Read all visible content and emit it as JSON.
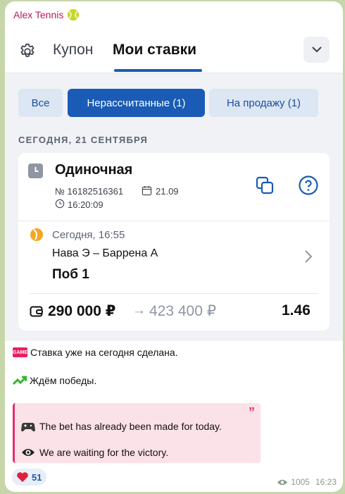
{
  "channel": {
    "sender_name": "Alex Tennis",
    "sender_icon": "tennis-ball-icon"
  },
  "header": {
    "settings_icon": "gear-icon",
    "tab_coupon": "Купон",
    "tab_my_bets": "Мои ставки",
    "collapse_icon": "chevron-down-icon"
  },
  "filters": {
    "all": "Все",
    "unsettled": "Нерассчитанные (1)",
    "for_sale": "На продажу (1)"
  },
  "section_date": "СЕГОДНЯ, 21 СЕНТЯБРЯ",
  "bet": {
    "type": "Одиночная",
    "number": "№ 16182516361",
    "date": "21.09",
    "time": "16:20:09",
    "event_time": "Сегодня, 16:55",
    "event_name": "Нава Э – Баррена А",
    "pick": "Поб 1",
    "stake": "290 000 ₽",
    "arrow": "→",
    "payout": "423 400 ₽",
    "odds": "1.46"
  },
  "message": {
    "game_badge": "GAME",
    "line1": "Ставка уже на сегодня сделана.",
    "line2": "Ждём победы.",
    "quote_line1": "The bet has already been made for today.",
    "quote_line2": "We are waiting for the victory.",
    "quote_mark": "”"
  },
  "reaction": {
    "emoji": "heart-icon",
    "count": "51"
  },
  "meta": {
    "views": "1005",
    "time": "16:23"
  },
  "colors": {
    "accent": "#1a5bb5",
    "sender": "#c2185b",
    "quote_border": "#e0306a",
    "background": "#c7d6a9"
  }
}
